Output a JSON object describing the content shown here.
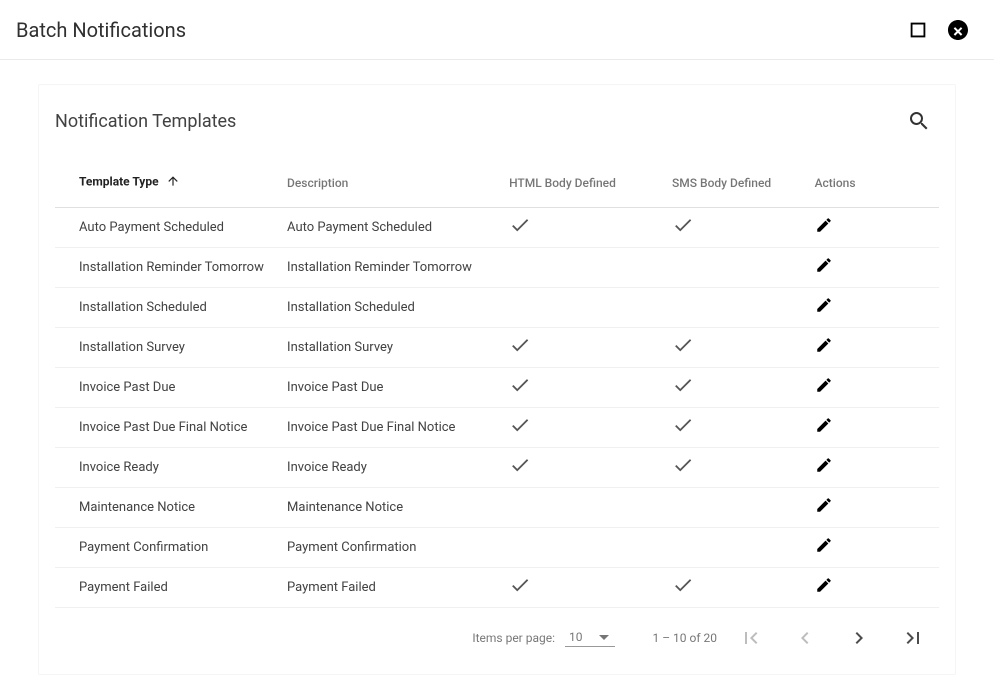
{
  "dialog": {
    "title": "Batch Notifications"
  },
  "card": {
    "title": "Notification Templates"
  },
  "columns": {
    "templateType": "Template Type",
    "description": "Description",
    "htmlBody": "HTML Body Defined",
    "smsBody": "SMS Body Defined",
    "actions": "Actions"
  },
  "rows": [
    {
      "type": "Auto Payment Scheduled",
      "desc": "Auto Payment Scheduled",
      "html": true,
      "sms": true
    },
    {
      "type": "Installation Reminder Tomorrow",
      "desc": "Installation Reminder Tomorrow",
      "html": false,
      "sms": false
    },
    {
      "type": "Installation Scheduled",
      "desc": "Installation Scheduled",
      "html": false,
      "sms": false
    },
    {
      "type": "Installation Survey",
      "desc": "Installation Survey",
      "html": true,
      "sms": true
    },
    {
      "type": "Invoice Past Due",
      "desc": "Invoice Past Due",
      "html": true,
      "sms": true
    },
    {
      "type": "Invoice Past Due Final Notice",
      "desc": "Invoice Past Due Final Notice",
      "html": true,
      "sms": true
    },
    {
      "type": "Invoice Ready",
      "desc": "Invoice Ready",
      "html": true,
      "sms": true
    },
    {
      "type": "Maintenance Notice",
      "desc": "Maintenance Notice",
      "html": false,
      "sms": false
    },
    {
      "type": "Payment Confirmation",
      "desc": "Payment Confirmation",
      "html": false,
      "sms": false
    },
    {
      "type": "Payment Failed",
      "desc": "Payment Failed",
      "html": true,
      "sms": true
    }
  ],
  "paginator": {
    "itemsPerPageLabel": "Items per page:",
    "pageSize": "10",
    "rangeLabel": "1 – 10 of 20"
  }
}
